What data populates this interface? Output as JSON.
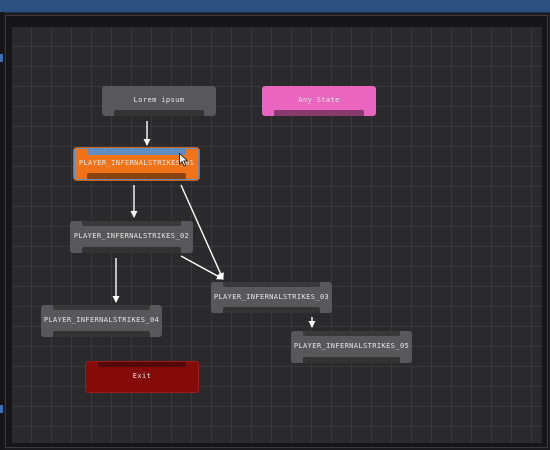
{
  "window": {
    "topbar_color": "#2c5080"
  },
  "graph": {
    "grid": true,
    "background_color": "#2a2a2d",
    "edge_color": "#ffffff"
  },
  "nodes": [
    {
      "id": "lorem",
      "label": "Lorem ipsum",
      "style": "default"
    },
    {
      "id": "any_state",
      "label": "Any State",
      "style": "any-state"
    },
    {
      "id": "s01",
      "label": "PLAYER_INFERNALSTRIKES_01",
      "style": "selected"
    },
    {
      "id": "s02",
      "label": "PLAYER_INFERNALSTRIKES_02",
      "style": "default"
    },
    {
      "id": "s03",
      "label": "PLAYER_INFERNALSTRIKES_03",
      "style": "default"
    },
    {
      "id": "s04",
      "label": "PLAYER_INFERNALSTRIKES_04",
      "style": "default"
    },
    {
      "id": "s05",
      "label": "PLAYER_INFERNALSTRIKES_05",
      "style": "default"
    },
    {
      "id": "exit",
      "label": "Exit",
      "style": "exit"
    }
  ],
  "transitions": [
    {
      "from": "lorem",
      "to": "s01"
    },
    {
      "from": "s01",
      "to": "s02"
    },
    {
      "from": "s01",
      "to": "s03"
    },
    {
      "from": "s02",
      "to": "s03"
    },
    {
      "from": "s02",
      "to": "s04"
    },
    {
      "from": "s03",
      "to": "s05"
    }
  ],
  "colors": {
    "selected_node": "#f07417",
    "selected_outline": "#5f91c8",
    "any_state": "#ea65bd",
    "exit": "#850b0b",
    "default_node": "#58585a"
  }
}
